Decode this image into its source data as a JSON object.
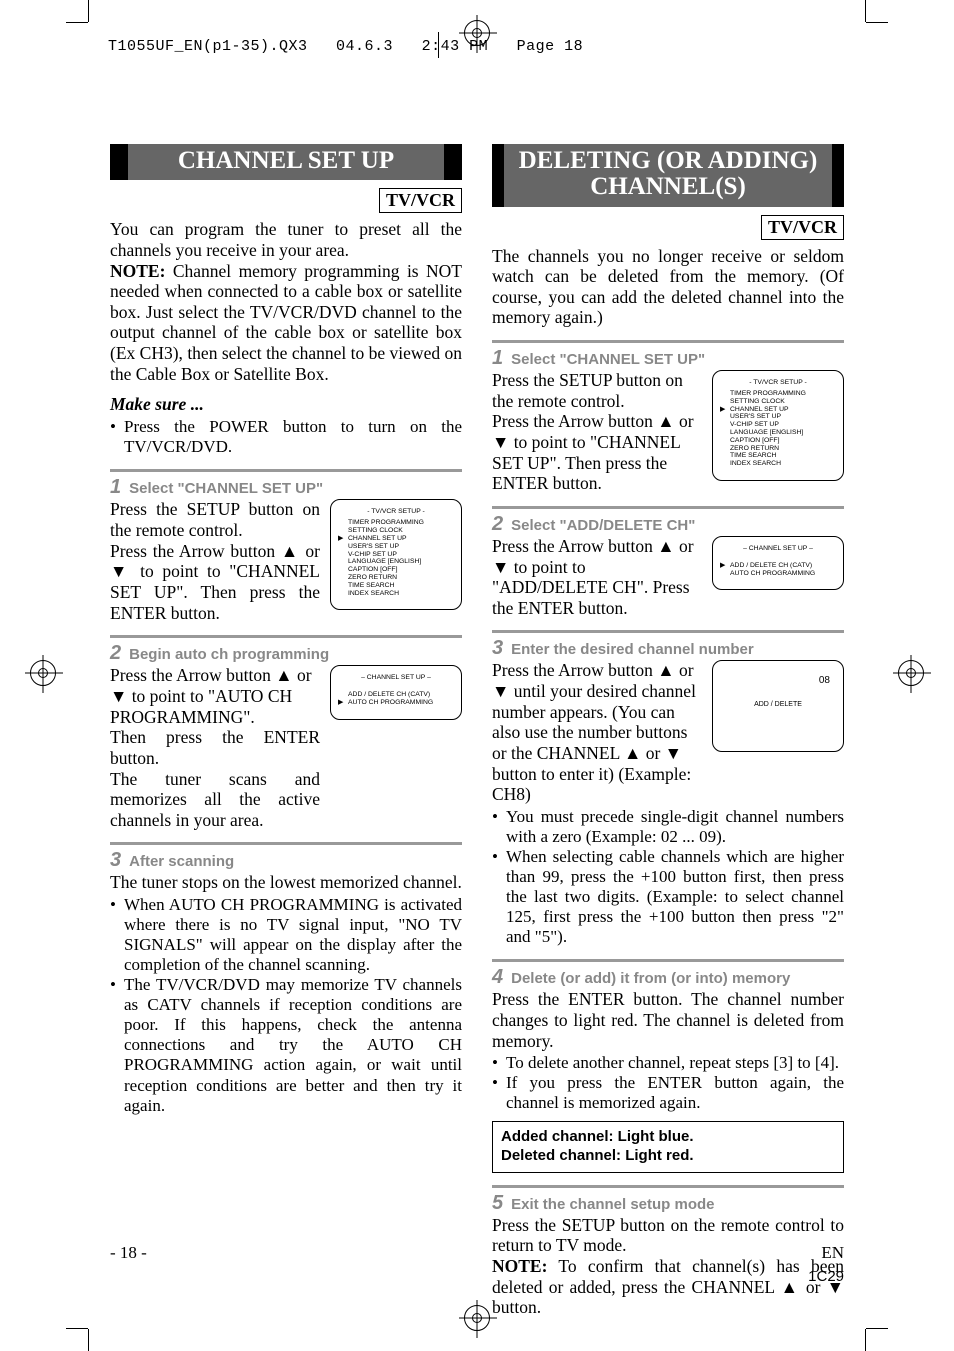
{
  "runhead": {
    "file": "T1055UF_EN(p1-35).QX3",
    "date": "04.6.3",
    "time": "2:43 PM",
    "page_label": "Page 18"
  },
  "left": {
    "title": "CHANNEL SET UP",
    "tvvcr": "TV/VCR",
    "intro": "You can program the tuner to preset all the channels you receive in your area.",
    "note_label": "NOTE:",
    "note": " Channel memory programming is NOT needed when connected to a cable box or satellite box. Just select the TV/VCR/DVD channel to the output channel of the cable box or satellite box (Ex CH3), then select the channel to be viewed on the Cable Box or Satellite Box.",
    "make_sure": "Make sure ...",
    "make_sure_item": "Press the POWER button to turn on the TV/VCR/DVD.",
    "step1": {
      "num": "1",
      "head": "Select \"CHANNEL SET UP\"",
      "p1": "Press the SETUP button on the remote control.",
      "p2": "Press the Arrow button ▲ or ▼ to point to \"CHANNEL SET UP\". Then press the ENTER button.",
      "osd": {
        "title": "- TV/VCR SETUP -",
        "rows": [
          {
            "ptr": "",
            "lbl": "TIMER PROGRAMMING"
          },
          {
            "ptr": "",
            "lbl": "SETTING CLOCK"
          },
          {
            "ptr": "▶",
            "lbl": "CHANNEL SET UP"
          },
          {
            "ptr": "",
            "lbl": "USER'S SET UP"
          },
          {
            "ptr": "",
            "lbl": "V-CHIP SET UP"
          },
          {
            "ptr": "",
            "lbl": "LANGUAGE   [ENGLISH]"
          },
          {
            "ptr": "",
            "lbl": "CAPTION   [OFF]"
          },
          {
            "ptr": "",
            "lbl": "ZERO RETURN"
          },
          {
            "ptr": "",
            "lbl": "TIME SEARCH"
          },
          {
            "ptr": "",
            "lbl": "INDEX SEARCH"
          }
        ]
      }
    },
    "step2": {
      "num": "2",
      "head": "Begin auto ch programming",
      "p1": "Press the Arrow button ▲ or ▼ to point to \"AUTO CH PROGRAMMING\".",
      "p2": "Then press the ENTER button.",
      "p3": "The tuner scans and memorizes all the active channels in your area.",
      "osd": {
        "title": "– CHANNEL SET UP –",
        "rows": [
          {
            "ptr": "",
            "lbl": "ADD / DELETE CH (CATV)"
          },
          {
            "ptr": "▶",
            "lbl": "AUTO CH PROGRAMMING"
          }
        ]
      }
    },
    "step3": {
      "num": "3",
      "head": "After scanning",
      "p1": "The tuner stops on the lowest memorized channel.",
      "b1": "When AUTO CH PROGRAMMING is activated where there is no TV signal input, \"NO TV SIGNALS\" will appear on the display after the completion of the channel scanning.",
      "b2": "The TV/VCR/DVD may memorize TV channels as CATV channels if reception conditions are poor. If this happens, check the antenna connections and try the AUTO CH PROGRAMMING action again, or wait until reception conditions are better and then try it again."
    }
  },
  "right": {
    "title": "DELETING (OR ADDING) CHANNEL(S)",
    "tvvcr": "TV/VCR",
    "intro": "The channels you no longer receive or seldom watch can be deleted from the memory. (Of course, you can add the deleted channel into the memory again.)",
    "step1": {
      "num": "1",
      "head": "Select \"CHANNEL SET UP\"",
      "p1": "Press the SETUP button on the remote control.",
      "p2": "Press the Arrow button ▲ or ▼ to point to \"CHANNEL SET UP\". Then press the ENTER button.",
      "osd": {
        "title": "- TV/VCR SETUP -",
        "rows": [
          {
            "ptr": "",
            "lbl": "TIMER PROGRAMMING"
          },
          {
            "ptr": "",
            "lbl": "SETTING CLOCK"
          },
          {
            "ptr": "▶",
            "lbl": "CHANNEL SET UP"
          },
          {
            "ptr": "",
            "lbl": "USER'S SET UP"
          },
          {
            "ptr": "",
            "lbl": "V-CHIP SET UP"
          },
          {
            "ptr": "",
            "lbl": "LANGUAGE   [ENGLISH]"
          },
          {
            "ptr": "",
            "lbl": "CAPTION   [OFF]"
          },
          {
            "ptr": "",
            "lbl": "ZERO RETURN"
          },
          {
            "ptr": "",
            "lbl": "TIME SEARCH"
          },
          {
            "ptr": "",
            "lbl": "INDEX SEARCH"
          }
        ]
      }
    },
    "step2": {
      "num": "2",
      "head": "Select \"ADD/DELETE CH\"",
      "p1": "Press the Arrow button ▲ or ▼ to point to \"ADD/DELETE CH\". Press the ENTER button.",
      "osd": {
        "title": "– CHANNEL SET UP –",
        "rows": [
          {
            "ptr": "▶",
            "lbl": "ADD / DELETE CH (CATV)"
          },
          {
            "ptr": "",
            "lbl": "AUTO CH PROGRAMMING"
          }
        ]
      }
    },
    "step3": {
      "num": "3",
      "head": "Enter the desired channel number",
      "p1": "Press the Arrow button ▲ or ▼ until your desired channel number appears. (You can also use the number buttons or the CHANNEL ▲ or ▼ button to enter it) (Example: CH8)",
      "osd": {
        "chnum": "08",
        "adddel": "ADD / DELETE"
      },
      "b1": "You must precede single-digit channel numbers with a zero (Example: 02 ...  09).",
      "b2": "When selecting cable channels which are higher than 99, press the +100 button first, then press the last two digits. (Example: to select channel 125, first press the +100 button then press \"2\" and \"5\")."
    },
    "step4": {
      "num": "4",
      "head": "Delete (or add) it from (or into) memory",
      "p1": "Press the ENTER button. The channel number changes to light red. The channel is deleted from memory.",
      "b1": "To delete another channel, repeat steps [3] to [4].",
      "b2": "If you press the ENTER button again, the channel is memorized again.",
      "callout1": "Added channel: Light blue.",
      "callout2": "Deleted channel: Light red."
    },
    "step5": {
      "num": "5",
      "head": "Exit the channel setup mode",
      "p1": "Press the SETUP button on the remote control to return to TV mode.",
      "note_label": "NOTE:",
      "note": " To confirm that channel(s) has been deleted or added, press the CHANNEL ▲ or ▼ button."
    }
  },
  "footer": {
    "page": "- 18 -",
    "en": "EN",
    "code": "1C29"
  }
}
